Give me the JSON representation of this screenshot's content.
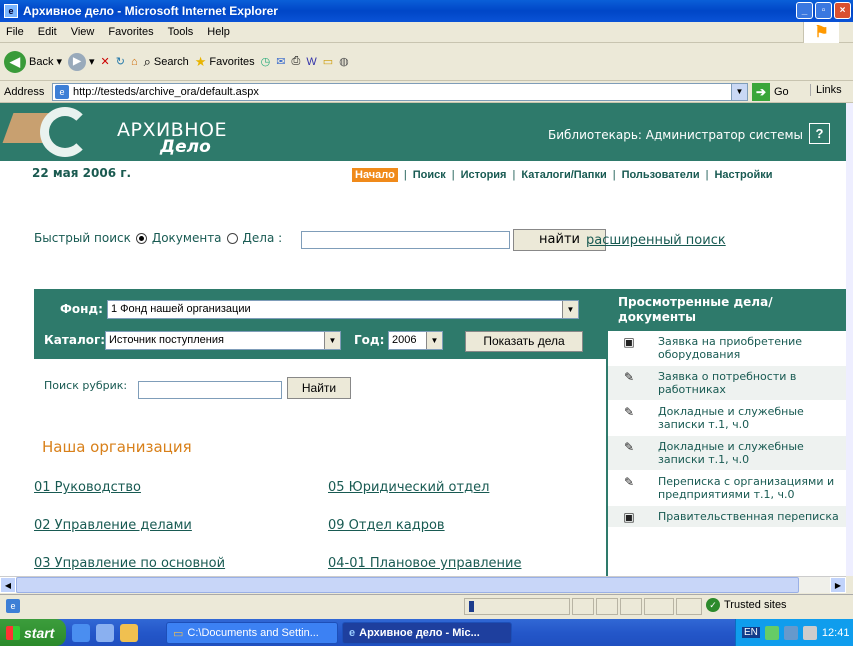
{
  "window": {
    "title": "Архивное дело - Microsoft Internet Explorer"
  },
  "menu": [
    "File",
    "Edit",
    "View",
    "Favorites",
    "Tools",
    "Help"
  ],
  "toolbar": {
    "back": "Back",
    "search": "Search",
    "favorites": "Favorites"
  },
  "address": {
    "label": "Address",
    "url": "http://testeds/archive_ora/default.aspx",
    "go": "Go",
    "links": "Links"
  },
  "header": {
    "logo_line1": "АРХИВНОЕ",
    "logo_line2": "Дело",
    "user": "Библиотекарь: Администратор системы",
    "help": "?"
  },
  "date": "22 мая 2006 г.",
  "nav": [
    "Начало",
    "Поиск",
    "История",
    "Каталоги/Папки",
    "Пользователи",
    "Настройки"
  ],
  "quick_search": {
    "label": "Быстрый поиск",
    "opt_doc": "Документа",
    "opt_case": "Дела :",
    "button": "найти",
    "advanced": "расширенный поиск"
  },
  "filter": {
    "fund_label": "Фонд:",
    "fund_value": "1 Фонд нашей организации",
    "catalog_label": "Каталог:",
    "catalog_value": "Источник поступления",
    "year_label": "Год:",
    "year_value": "2006",
    "show_button": "Показать дела"
  },
  "rubric": {
    "label": "Поиск рубрик:",
    "button": "Найти"
  },
  "org": {
    "title": "Наша организация",
    "departments": [
      "01 Руководство",
      "05 Юридический отдел",
      "02 Управление делами",
      "09 Отдел кадров",
      "03 Управление по основной",
      "04-01 Плановое управление"
    ]
  },
  "recent": {
    "title": "Просмотренные дела/документы",
    "items": [
      {
        "text": "Заявка на приобретение оборудования",
        "icon": "document-icon"
      },
      {
        "text": "Заявка о потребности в работниках",
        "icon": "case-icon"
      },
      {
        "text": "Докладные и служебные записки т.1, ч.0",
        "icon": "case-icon"
      },
      {
        "text": "Докладные и служебные записки т.1, ч.0",
        "icon": "case-icon"
      },
      {
        "text": "Переписка с организациями и предприятиями т.1, ч.0",
        "icon": "case-icon"
      },
      {
        "text": "Правительственная переписка",
        "icon": "document-icon"
      }
    ]
  },
  "status": {
    "zone": "Trusted sites"
  },
  "taskbar": {
    "start": "start",
    "tasks": [
      "C:\\Documents and Settin...",
      "Архивное дело - Mic..."
    ],
    "lang": "EN",
    "clock": "12:41"
  },
  "colors": {
    "brand": "#2e7a6b",
    "accent": "#f08a1a",
    "link": "#185a52"
  }
}
